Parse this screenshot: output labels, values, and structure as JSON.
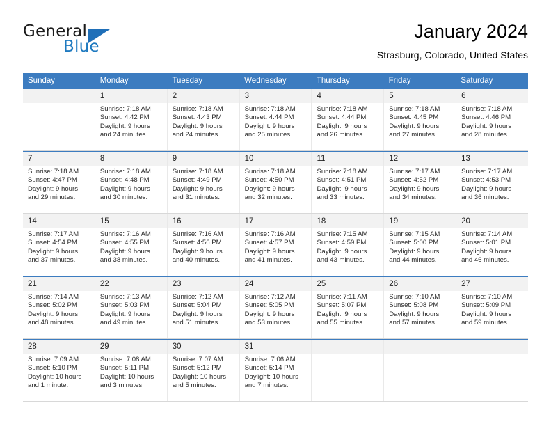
{
  "logo": {
    "word_top": "General",
    "word_bottom": "Blue",
    "accent_color": "#1f6fb8"
  },
  "header": {
    "title": "January 2024",
    "subtitle": "Strasburg, Colorado, United States",
    "header_bg": "#3c7cc0"
  },
  "weekdays": [
    "Sunday",
    "Monday",
    "Tuesday",
    "Wednesday",
    "Thursday",
    "Friday",
    "Saturday"
  ],
  "labels": {
    "sunrise": "Sunrise:",
    "sunset": "Sunset:",
    "daylight": "Daylight:"
  },
  "weeks": [
    [
      {
        "day": "",
        "sunrise": "",
        "sunset": "",
        "daylight_1": "",
        "daylight_2": ""
      },
      {
        "day": "1",
        "sunrise": "Sunrise: 7:18 AM",
        "sunset": "Sunset: 4:42 PM",
        "daylight_1": "Daylight: 9 hours",
        "daylight_2": "and 24 minutes."
      },
      {
        "day": "2",
        "sunrise": "Sunrise: 7:18 AM",
        "sunset": "Sunset: 4:43 PM",
        "daylight_1": "Daylight: 9 hours",
        "daylight_2": "and 24 minutes."
      },
      {
        "day": "3",
        "sunrise": "Sunrise: 7:18 AM",
        "sunset": "Sunset: 4:44 PM",
        "daylight_1": "Daylight: 9 hours",
        "daylight_2": "and 25 minutes."
      },
      {
        "day": "4",
        "sunrise": "Sunrise: 7:18 AM",
        "sunset": "Sunset: 4:44 PM",
        "daylight_1": "Daylight: 9 hours",
        "daylight_2": "and 26 minutes."
      },
      {
        "day": "5",
        "sunrise": "Sunrise: 7:18 AM",
        "sunset": "Sunset: 4:45 PM",
        "daylight_1": "Daylight: 9 hours",
        "daylight_2": "and 27 minutes."
      },
      {
        "day": "6",
        "sunrise": "Sunrise: 7:18 AM",
        "sunset": "Sunset: 4:46 PM",
        "daylight_1": "Daylight: 9 hours",
        "daylight_2": "and 28 minutes."
      }
    ],
    [
      {
        "day": "7",
        "sunrise": "Sunrise: 7:18 AM",
        "sunset": "Sunset: 4:47 PM",
        "daylight_1": "Daylight: 9 hours",
        "daylight_2": "and 29 minutes."
      },
      {
        "day": "8",
        "sunrise": "Sunrise: 7:18 AM",
        "sunset": "Sunset: 4:48 PM",
        "daylight_1": "Daylight: 9 hours",
        "daylight_2": "and 30 minutes."
      },
      {
        "day": "9",
        "sunrise": "Sunrise: 7:18 AM",
        "sunset": "Sunset: 4:49 PM",
        "daylight_1": "Daylight: 9 hours",
        "daylight_2": "and 31 minutes."
      },
      {
        "day": "10",
        "sunrise": "Sunrise: 7:18 AM",
        "sunset": "Sunset: 4:50 PM",
        "daylight_1": "Daylight: 9 hours",
        "daylight_2": "and 32 minutes."
      },
      {
        "day": "11",
        "sunrise": "Sunrise: 7:18 AM",
        "sunset": "Sunset: 4:51 PM",
        "daylight_1": "Daylight: 9 hours",
        "daylight_2": "and 33 minutes."
      },
      {
        "day": "12",
        "sunrise": "Sunrise: 7:17 AM",
        "sunset": "Sunset: 4:52 PM",
        "daylight_1": "Daylight: 9 hours",
        "daylight_2": "and 34 minutes."
      },
      {
        "day": "13",
        "sunrise": "Sunrise: 7:17 AM",
        "sunset": "Sunset: 4:53 PM",
        "daylight_1": "Daylight: 9 hours",
        "daylight_2": "and 36 minutes."
      }
    ],
    [
      {
        "day": "14",
        "sunrise": "Sunrise: 7:17 AM",
        "sunset": "Sunset: 4:54 PM",
        "daylight_1": "Daylight: 9 hours",
        "daylight_2": "and 37 minutes."
      },
      {
        "day": "15",
        "sunrise": "Sunrise: 7:16 AM",
        "sunset": "Sunset: 4:55 PM",
        "daylight_1": "Daylight: 9 hours",
        "daylight_2": "and 38 minutes."
      },
      {
        "day": "16",
        "sunrise": "Sunrise: 7:16 AM",
        "sunset": "Sunset: 4:56 PM",
        "daylight_1": "Daylight: 9 hours",
        "daylight_2": "and 40 minutes."
      },
      {
        "day": "17",
        "sunrise": "Sunrise: 7:16 AM",
        "sunset": "Sunset: 4:57 PM",
        "daylight_1": "Daylight: 9 hours",
        "daylight_2": "and 41 minutes."
      },
      {
        "day": "18",
        "sunrise": "Sunrise: 7:15 AM",
        "sunset": "Sunset: 4:59 PM",
        "daylight_1": "Daylight: 9 hours",
        "daylight_2": "and 43 minutes."
      },
      {
        "day": "19",
        "sunrise": "Sunrise: 7:15 AM",
        "sunset": "Sunset: 5:00 PM",
        "daylight_1": "Daylight: 9 hours",
        "daylight_2": "and 44 minutes."
      },
      {
        "day": "20",
        "sunrise": "Sunrise: 7:14 AM",
        "sunset": "Sunset: 5:01 PM",
        "daylight_1": "Daylight: 9 hours",
        "daylight_2": "and 46 minutes."
      }
    ],
    [
      {
        "day": "21",
        "sunrise": "Sunrise: 7:14 AM",
        "sunset": "Sunset: 5:02 PM",
        "daylight_1": "Daylight: 9 hours",
        "daylight_2": "and 48 minutes."
      },
      {
        "day": "22",
        "sunrise": "Sunrise: 7:13 AM",
        "sunset": "Sunset: 5:03 PM",
        "daylight_1": "Daylight: 9 hours",
        "daylight_2": "and 49 minutes."
      },
      {
        "day": "23",
        "sunrise": "Sunrise: 7:12 AM",
        "sunset": "Sunset: 5:04 PM",
        "daylight_1": "Daylight: 9 hours",
        "daylight_2": "and 51 minutes."
      },
      {
        "day": "24",
        "sunrise": "Sunrise: 7:12 AM",
        "sunset": "Sunset: 5:05 PM",
        "daylight_1": "Daylight: 9 hours",
        "daylight_2": "and 53 minutes."
      },
      {
        "day": "25",
        "sunrise": "Sunrise: 7:11 AM",
        "sunset": "Sunset: 5:07 PM",
        "daylight_1": "Daylight: 9 hours",
        "daylight_2": "and 55 minutes."
      },
      {
        "day": "26",
        "sunrise": "Sunrise: 7:10 AM",
        "sunset": "Sunset: 5:08 PM",
        "daylight_1": "Daylight: 9 hours",
        "daylight_2": "and 57 minutes."
      },
      {
        "day": "27",
        "sunrise": "Sunrise: 7:10 AM",
        "sunset": "Sunset: 5:09 PM",
        "daylight_1": "Daylight: 9 hours",
        "daylight_2": "and 59 minutes."
      }
    ],
    [
      {
        "day": "28",
        "sunrise": "Sunrise: 7:09 AM",
        "sunset": "Sunset: 5:10 PM",
        "daylight_1": "Daylight: 10 hours",
        "daylight_2": "and 1 minute."
      },
      {
        "day": "29",
        "sunrise": "Sunrise: 7:08 AM",
        "sunset": "Sunset: 5:11 PM",
        "daylight_1": "Daylight: 10 hours",
        "daylight_2": "and 3 minutes."
      },
      {
        "day": "30",
        "sunrise": "Sunrise: 7:07 AM",
        "sunset": "Sunset: 5:12 PM",
        "daylight_1": "Daylight: 10 hours",
        "daylight_2": "and 5 minutes."
      },
      {
        "day": "31",
        "sunrise": "Sunrise: 7:06 AM",
        "sunset": "Sunset: 5:14 PM",
        "daylight_1": "Daylight: 10 hours",
        "daylight_2": "and 7 minutes."
      },
      {
        "day": "",
        "sunrise": "",
        "sunset": "",
        "daylight_1": "",
        "daylight_2": ""
      },
      {
        "day": "",
        "sunrise": "",
        "sunset": "",
        "daylight_1": "",
        "daylight_2": ""
      },
      {
        "day": "",
        "sunrise": "",
        "sunset": "",
        "daylight_1": "",
        "daylight_2": ""
      }
    ]
  ]
}
